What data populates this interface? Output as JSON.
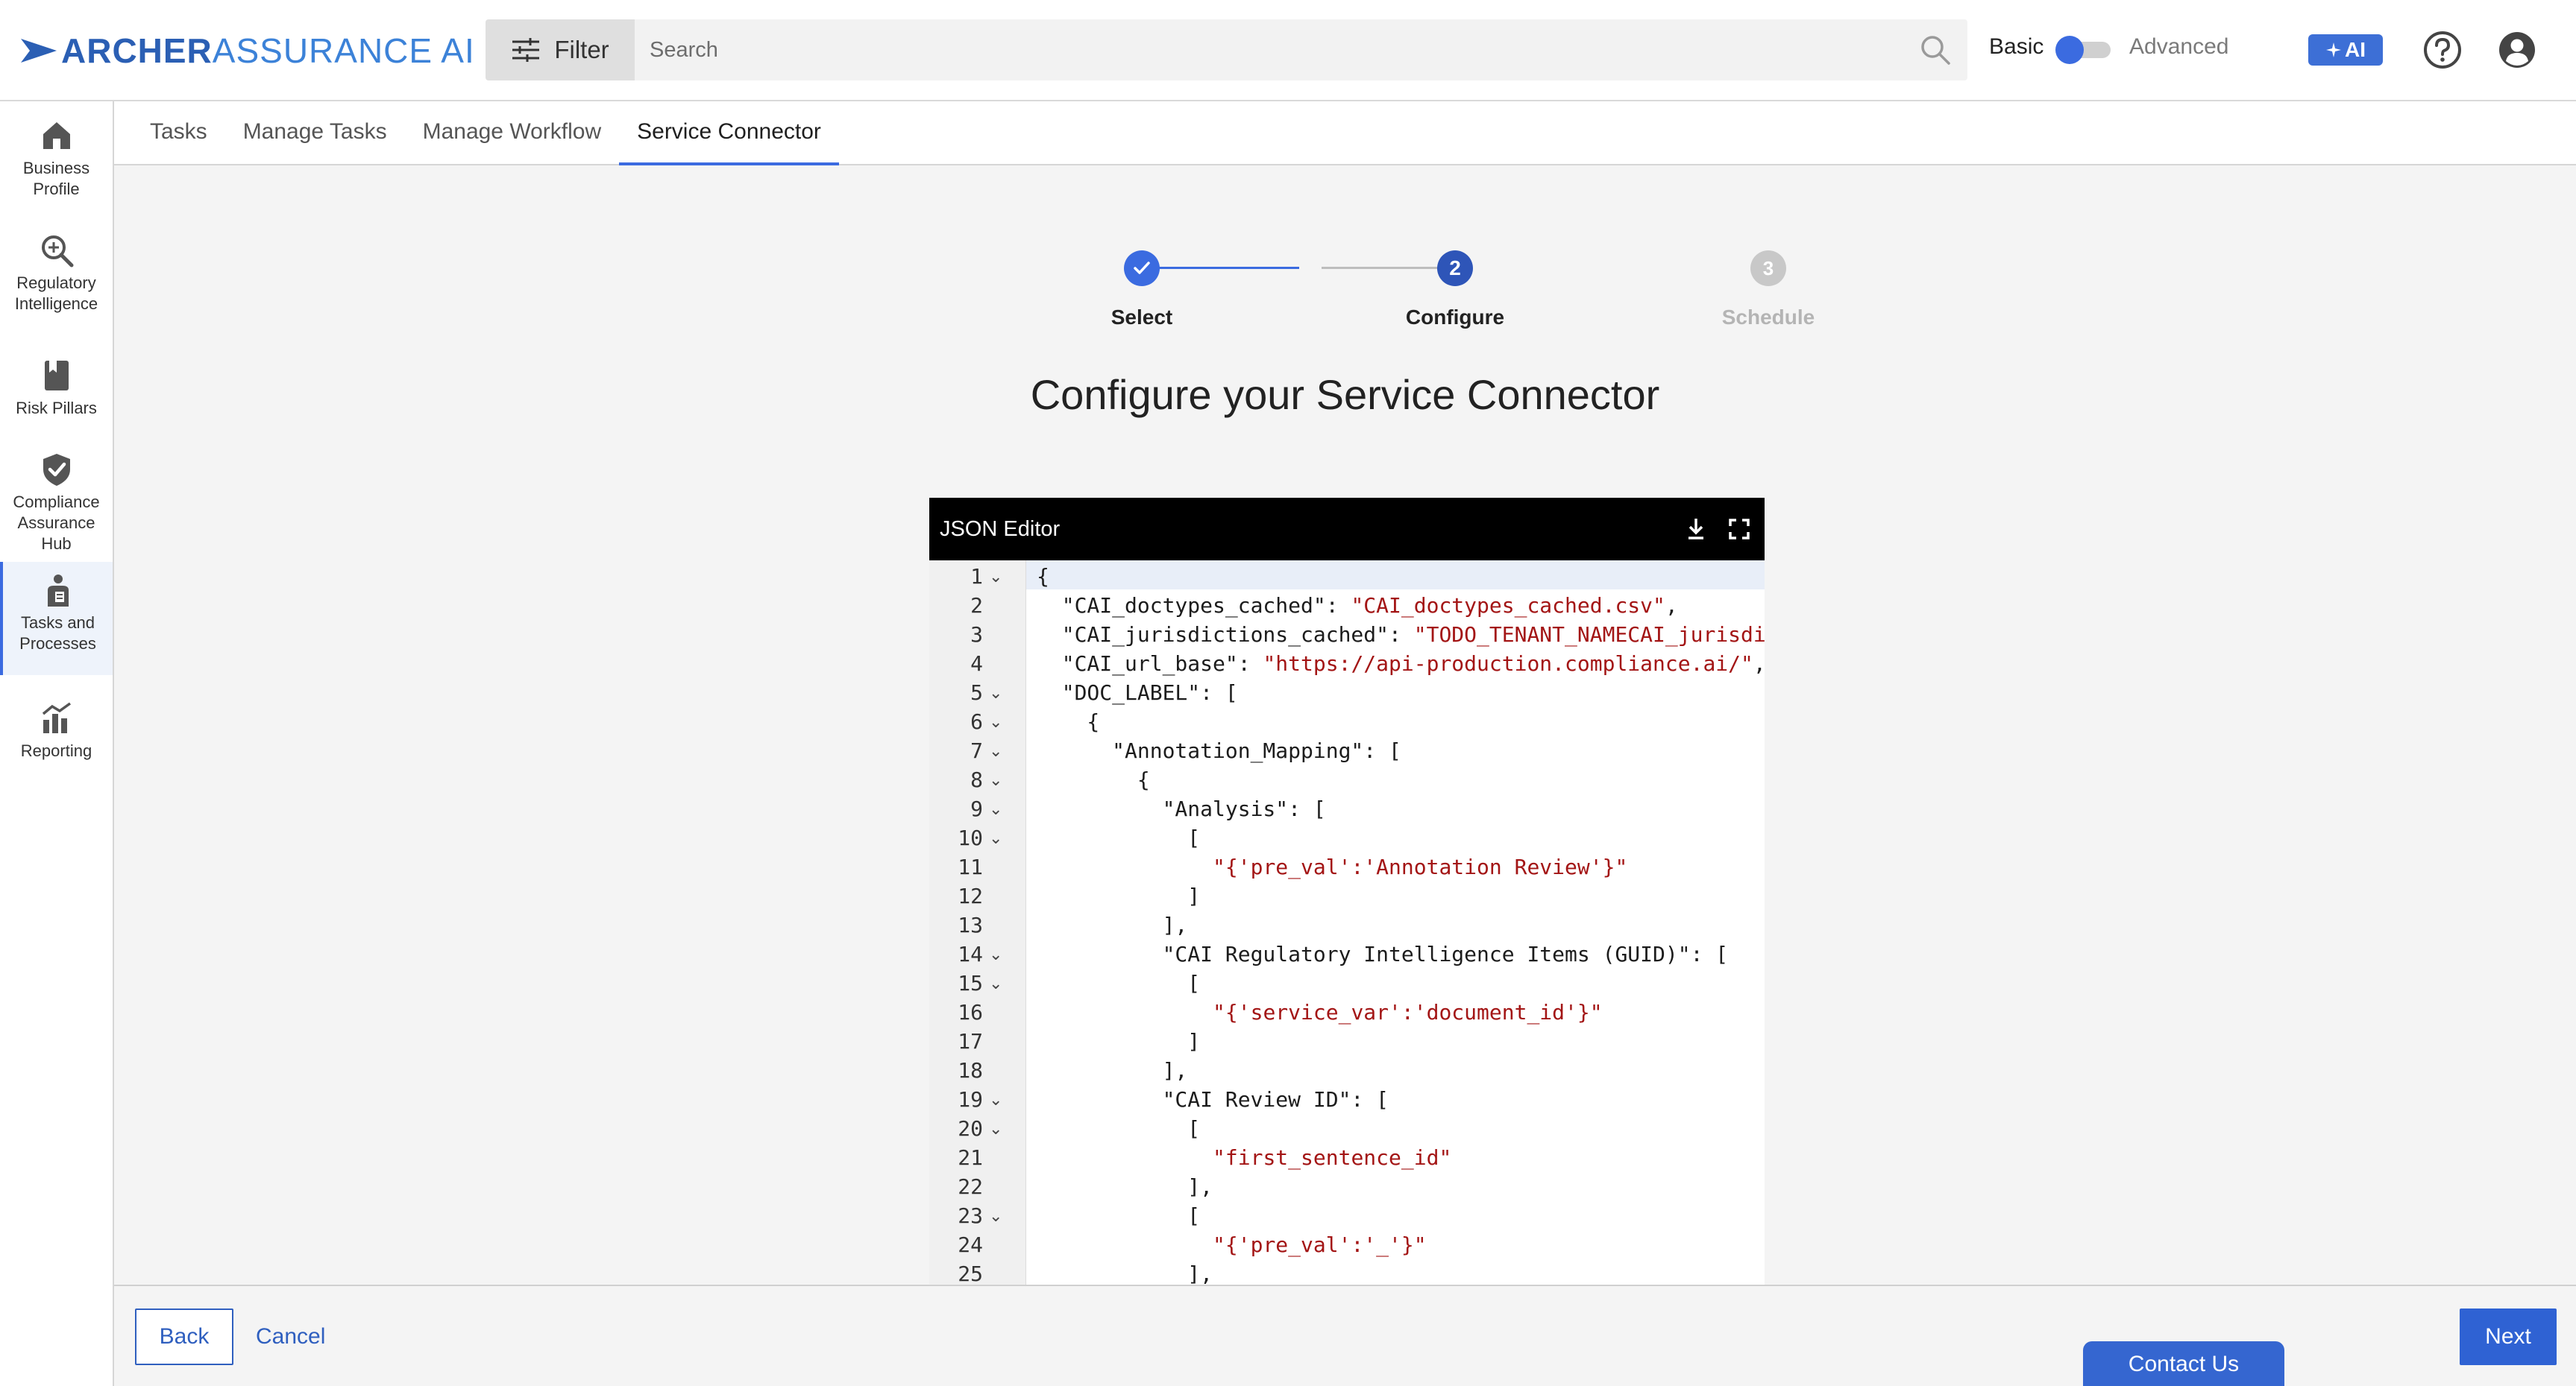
{
  "app": {
    "logo_bold": "ARCHER",
    "logo_light": "ASSURANCE AI"
  },
  "topbar": {
    "filter_label": "Filter",
    "search_placeholder": "Search",
    "mode_basic": "Basic",
    "mode_advanced": "Advanced",
    "ai_label": "AI"
  },
  "sidebar": {
    "items": [
      {
        "label_1": "Business",
        "label_2": "Profile"
      },
      {
        "label_1": "Regulatory",
        "label_2": "Intelligence"
      },
      {
        "label_1": "Risk Pillars"
      },
      {
        "label_1": "Compliance",
        "label_2": "Assurance",
        "label_3": "Hub"
      },
      {
        "label_1": "Tasks and",
        "label_2": "Processes"
      },
      {
        "label_1": "Reporting"
      }
    ]
  },
  "tabs": [
    "Tasks",
    "Manage Tasks",
    "Manage Workflow",
    "Service Connector"
  ],
  "stepper": {
    "steps": [
      {
        "label": "Select",
        "number": "1",
        "state": "done"
      },
      {
        "label": "Configure",
        "number": "2",
        "state": "current"
      },
      {
        "label": "Schedule",
        "number": "3",
        "state": "pending"
      }
    ]
  },
  "page": {
    "heading": "Configure your Service Connector"
  },
  "editor": {
    "title": "JSON Editor",
    "lines": [
      {
        "num": "1",
        "fold": true,
        "indent": "",
        "key": "{",
        "value": "",
        "tail": ""
      },
      {
        "num": "2",
        "fold": false,
        "indent": "  ",
        "key": "\"CAI_doctypes_cached\": ",
        "value": "\"CAI_doctypes_cached.csv\"",
        "tail": ","
      },
      {
        "num": "3",
        "fold": false,
        "indent": "  ",
        "key": "\"CAI_jurisdictions_cached\": ",
        "value": "\"TODO_TENANT_NAMECAI_jurisdi",
        "tail": ""
      },
      {
        "num": "4",
        "fold": false,
        "indent": "  ",
        "key": "\"CAI_url_base\": ",
        "value": "\"https://api-production.compliance.ai/\"",
        "tail": ","
      },
      {
        "num": "5",
        "fold": true,
        "indent": "  ",
        "key": "\"DOC_LABEL\": [",
        "value": "",
        "tail": ""
      },
      {
        "num": "6",
        "fold": true,
        "indent": "    ",
        "key": "{",
        "value": "",
        "tail": ""
      },
      {
        "num": "7",
        "fold": true,
        "indent": "      ",
        "key": "\"Annotation_Mapping\": [",
        "value": "",
        "tail": ""
      },
      {
        "num": "8",
        "fold": true,
        "indent": "        ",
        "key": "{",
        "value": "",
        "tail": ""
      },
      {
        "num": "9",
        "fold": true,
        "indent": "          ",
        "key": "\"Analysis\": [",
        "value": "",
        "tail": ""
      },
      {
        "num": "10",
        "fold": true,
        "indent": "            ",
        "key": "[",
        "value": "",
        "tail": ""
      },
      {
        "num": "11",
        "fold": false,
        "indent": "              ",
        "key": "",
        "value": "\"{'pre_val':'Annotation Review'}\"",
        "tail": ""
      },
      {
        "num": "12",
        "fold": false,
        "indent": "            ",
        "key": "]",
        "value": "",
        "tail": ""
      },
      {
        "num": "13",
        "fold": false,
        "indent": "          ",
        "key": "],",
        "value": "",
        "tail": ""
      },
      {
        "num": "14",
        "fold": true,
        "indent": "          ",
        "key": "\"CAI Regulatory Intelligence Items (GUID)\": [",
        "value": "",
        "tail": ""
      },
      {
        "num": "15",
        "fold": true,
        "indent": "            ",
        "key": "[",
        "value": "",
        "tail": ""
      },
      {
        "num": "16",
        "fold": false,
        "indent": "              ",
        "key": "",
        "value": "\"{'service_var':'document_id'}\"",
        "tail": ""
      },
      {
        "num": "17",
        "fold": false,
        "indent": "            ",
        "key": "]",
        "value": "",
        "tail": ""
      },
      {
        "num": "18",
        "fold": false,
        "indent": "          ",
        "key": "],",
        "value": "",
        "tail": ""
      },
      {
        "num": "19",
        "fold": true,
        "indent": "          ",
        "key": "\"CAI Review ID\": [",
        "value": "",
        "tail": ""
      },
      {
        "num": "20",
        "fold": true,
        "indent": "            ",
        "key": "[",
        "value": "",
        "tail": ""
      },
      {
        "num": "21",
        "fold": false,
        "indent": "              ",
        "key": "",
        "value": "\"first_sentence_id\"",
        "tail": ""
      },
      {
        "num": "22",
        "fold": false,
        "indent": "            ",
        "key": "],",
        "value": "",
        "tail": ""
      },
      {
        "num": "23",
        "fold": true,
        "indent": "            ",
        "key": "[",
        "value": "",
        "tail": ""
      },
      {
        "num": "24",
        "fold": false,
        "indent": "              ",
        "key": "",
        "value": "\"{'pre_val':'_'}\"",
        "tail": ""
      },
      {
        "num": "25",
        "fold": false,
        "indent": "            ",
        "key": "],",
        "value": "",
        "tail": ""
      }
    ]
  },
  "footer": {
    "back_label": "Back",
    "cancel_label": "Cancel",
    "contact_label": "Contact Us",
    "next_label": "Next"
  },
  "colors": {
    "accent": "#3b6be0",
    "string_value": "#a31515",
    "editor_header": "#000000"
  },
  "icons": [
    "search-icon",
    "filter-sliders-icon",
    "help-icon",
    "user-icon",
    "download-icon",
    "fullscreen-icon",
    "checkmark-icon",
    "home-icon",
    "magnify-icon",
    "book-icon",
    "shield-check-icon",
    "tasks-icon",
    "chart-icon",
    "sparkle-icon"
  ]
}
